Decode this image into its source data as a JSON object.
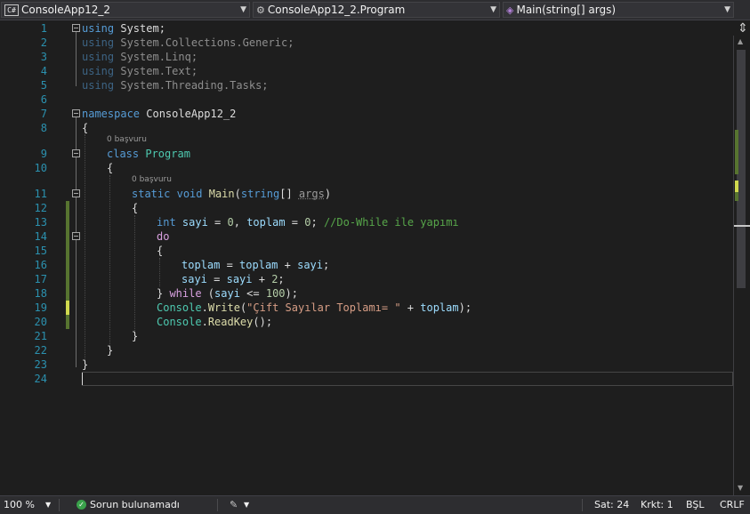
{
  "nav": {
    "project": "ConsoleApp12_2",
    "project_icon": "C#",
    "class": "ConsoleApp12_2.Program",
    "member": "Main(string[] args)"
  },
  "editor": {
    "line_numbers": [
      "1",
      "2",
      "3",
      "4",
      "5",
      "6",
      "7",
      "8",
      "9",
      "10",
      "11",
      "12",
      "13",
      "14",
      "15",
      "16",
      "17",
      "18",
      "19",
      "20",
      "21",
      "22",
      "23",
      "24"
    ],
    "codelens_class": "0 başvuru",
    "codelens_main": "0 başvuru",
    "code": {
      "l1": {
        "kw": "using",
        "rest": " System;"
      },
      "l2": {
        "kw": "using",
        "rest": " System.Collections.Generic;"
      },
      "l3": {
        "kw": "using",
        "rest": " System.Linq;"
      },
      "l4": {
        "kw": "using",
        "rest": " System.Text;"
      },
      "l5": {
        "kw": "using",
        "rest": " System.Threading.Tasks;"
      },
      "l7": {
        "kw": "namespace",
        "rest": " ConsoleApp12_2"
      },
      "l8": {
        "text": "{"
      },
      "l9": {
        "kw": "class",
        "type": "Program"
      },
      "l10": {
        "text": "{"
      },
      "l11": {
        "kw1": "static",
        "kw2": "void",
        "fn": "Main",
        "p1": "(",
        "kw3": "string",
        "p2": "[] ",
        "arg": "args",
        "p3": ")"
      },
      "l12": {
        "text": "{"
      },
      "l13": {
        "kw": "int",
        "v1": "sayi",
        "t1": " = ",
        "n1": "0",
        "t2": ", ",
        "v2": "toplam",
        "t3": " = ",
        "n2": "0",
        "t4": "; ",
        "comment": "//Do-While ile yapımı"
      },
      "l14": {
        "kw": "do"
      },
      "l15": {
        "text": "{"
      },
      "l16": {
        "v1": "toplam",
        "t1": " = ",
        "v2": "toplam",
        "t2": " + ",
        "v3": "sayi",
        "t3": ";"
      },
      "l17": {
        "v1": "sayi",
        "t1": " = ",
        "v2": "sayi",
        "t2": " + ",
        "n1": "2",
        "t3": ";"
      },
      "l18": {
        "t1": "} ",
        "kw": "while",
        "t2": " (",
        "v1": "sayi",
        "t3": " <= ",
        "n1": "100",
        "t4": ");"
      },
      "l19": {
        "ty": "Console",
        "t1": ".",
        "fn": "Write",
        "t2": "(",
        "str": "\"Çift Sayılar Toplamı= \"",
        "t3": " + ",
        "v1": "toplam",
        "t4": ");"
      },
      "l20": {
        "ty": "Console",
        "t1": ".",
        "fn": "ReadKey",
        "t2": "();"
      },
      "l21": {
        "text": "}"
      },
      "l22": {
        "text": "}"
      },
      "l23": {
        "text": "}"
      }
    }
  },
  "status": {
    "zoom": "100 %",
    "issues": "Sorun bulunamadı",
    "line": "Sat: 24",
    "column": "Krkt: 1",
    "insert_mode": "BŞL",
    "line_ending": "CRLF"
  },
  "colors": {
    "background": "#1e1e1e",
    "keyword": "#569cd6",
    "type": "#4ec9b0",
    "method": "#dcdcaa",
    "variable": "#9cdcfe",
    "string": "#d69d85",
    "comment": "#57a64a",
    "control_keyword": "#d8a0df",
    "line_number": "#2b91af",
    "saved_change": "#577430",
    "unsaved_change": "#d0d94e"
  }
}
